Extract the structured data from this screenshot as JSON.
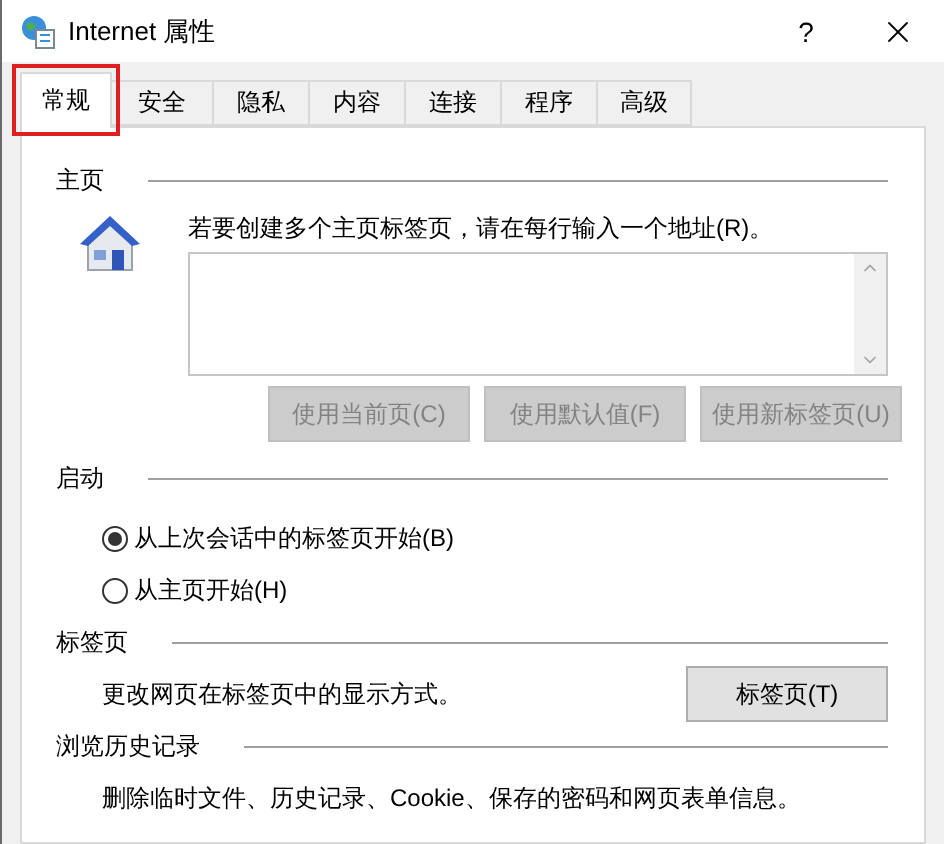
{
  "window": {
    "title": "Internet 属性",
    "help": "?"
  },
  "tabs": [
    {
      "label": "常规",
      "selected": true,
      "highlighted": true
    },
    {
      "label": "安全",
      "selected": false,
      "highlighted": false
    },
    {
      "label": "隐私",
      "selected": false,
      "highlighted": false
    },
    {
      "label": "内容",
      "selected": false,
      "highlighted": false
    },
    {
      "label": "连接",
      "selected": false,
      "highlighted": false
    },
    {
      "label": "程序",
      "selected": false,
      "highlighted": false
    },
    {
      "label": "高级",
      "selected": false,
      "highlighted": false
    }
  ],
  "homepage": {
    "title": "主页",
    "description": "若要创建多个主页标签页，请在每行输入一个地址(R)。",
    "buttons": [
      {
        "label": "使用当前页(C)",
        "disabled": true
      },
      {
        "label": "使用默认值(F)",
        "disabled": true
      },
      {
        "label": "使用新标签页(U)",
        "disabled": true
      }
    ]
  },
  "startup": {
    "title": "启动",
    "options": [
      {
        "label": "从上次会话中的标签页开始(B)",
        "selected": true
      },
      {
        "label": "从主页开始(H)",
        "selected": false
      }
    ]
  },
  "tab_settings": {
    "title": "标签页",
    "description": "更改网页在标签页中的显示方式。",
    "button": {
      "label": "标签页(T)",
      "disabled": false
    }
  },
  "history": {
    "title": "浏览历史记录",
    "description": "删除临时文件、历史记录、Cookie、保存的密码和网页表单信息。"
  }
}
